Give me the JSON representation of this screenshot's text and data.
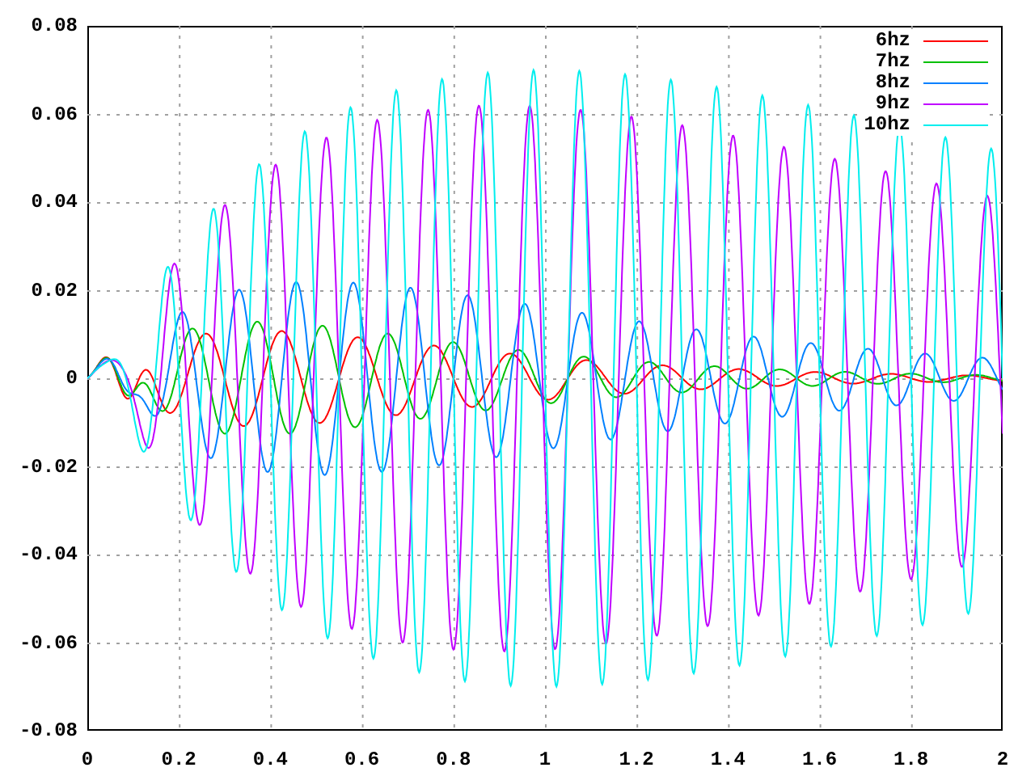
{
  "y_ticks": [
    "0.08",
    "0.06",
    "0.04",
    "0.02",
    "0",
    "-0.02",
    "-0.04",
    "-0.06",
    "-0.08"
  ],
  "x_ticks": [
    "0",
    "0.2",
    "0.4",
    "0.6",
    "0.8",
    "1",
    "1.2",
    "1.4",
    "1.6",
    "1.8",
    "2"
  ],
  "legend": [
    {
      "label": "6hz",
      "color": "#ff0000"
    },
    {
      "label": "7hz",
      "color": "#00c000"
    },
    {
      "label": "8hz",
      "color": "#0080ff"
    },
    {
      "label": "9hz",
      "color": "#c000ff"
    },
    {
      "label": "10hz",
      "color": "#00eeee"
    }
  ]
}
